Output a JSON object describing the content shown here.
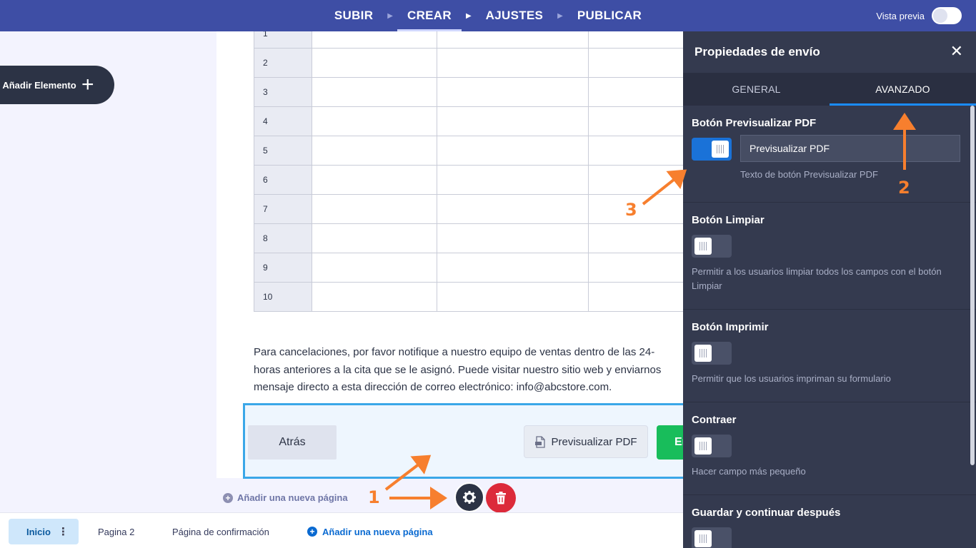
{
  "topnav": {
    "steps": [
      "SUBIR",
      "CREAR",
      "AJUSTES",
      "PUBLICAR"
    ],
    "preview_label": "Vista previa"
  },
  "add_element": {
    "label": "Añadir Elemento"
  },
  "matrix": {
    "rows": [
      "1",
      "2",
      "3",
      "4",
      "5",
      "6",
      "7",
      "8",
      "9",
      "10"
    ]
  },
  "form_text": {
    "line1": "Para cancelaciones, por favor notifique a nuestro equipo de ventas dentro de las 24-",
    "line2": "horas anteriores a la cita que se le asignó. Puede visitar nuestro sitio web y enviarnos",
    "line3": "mensaje directo a esta dirección de correo electrónico: info@abcstore.com."
  },
  "buttons": {
    "back": "Atrás",
    "preview_pdf": "Previsualizar PDF",
    "submit": "En"
  },
  "add_new_page": "Añadir una nueva página",
  "page_tabs": {
    "home": "Inicio",
    "page2": "Pagina 2",
    "confirm": "Página de confirmación",
    "add": "Añadir una nueva página"
  },
  "panel": {
    "title": "Propiedades de envío",
    "tabs": [
      "GENERAL",
      "AVANZADO"
    ],
    "active_tab": "AVANZADO",
    "sections": [
      {
        "title": "Botón Previsualizar PDF",
        "enabled": true,
        "input_value": "Previsualizar PDF",
        "desc": "Texto de botón Previsualizar PDF"
      },
      {
        "title": "Botón Limpiar",
        "enabled": false,
        "desc": "Permitir a los usuarios limpiar todos los campos con el botón Limpiar"
      },
      {
        "title": "Botón Imprimir",
        "enabled": false,
        "desc": "Permitir que los usuarios impriman su formulario"
      },
      {
        "title": "Contraer",
        "enabled": false,
        "desc": "Hacer campo más pequeño"
      },
      {
        "title": "Guardar y continuar después",
        "enabled": false
      }
    ]
  },
  "annotations": [
    "1",
    "2",
    "3"
  ],
  "colors": {
    "topbar": "#3e4ea5",
    "panel": "#343a4f",
    "accent": "#1a8cff",
    "arrow": "#f77f2e",
    "submit": "#18bd5b",
    "delete": "#dc2a3a"
  }
}
